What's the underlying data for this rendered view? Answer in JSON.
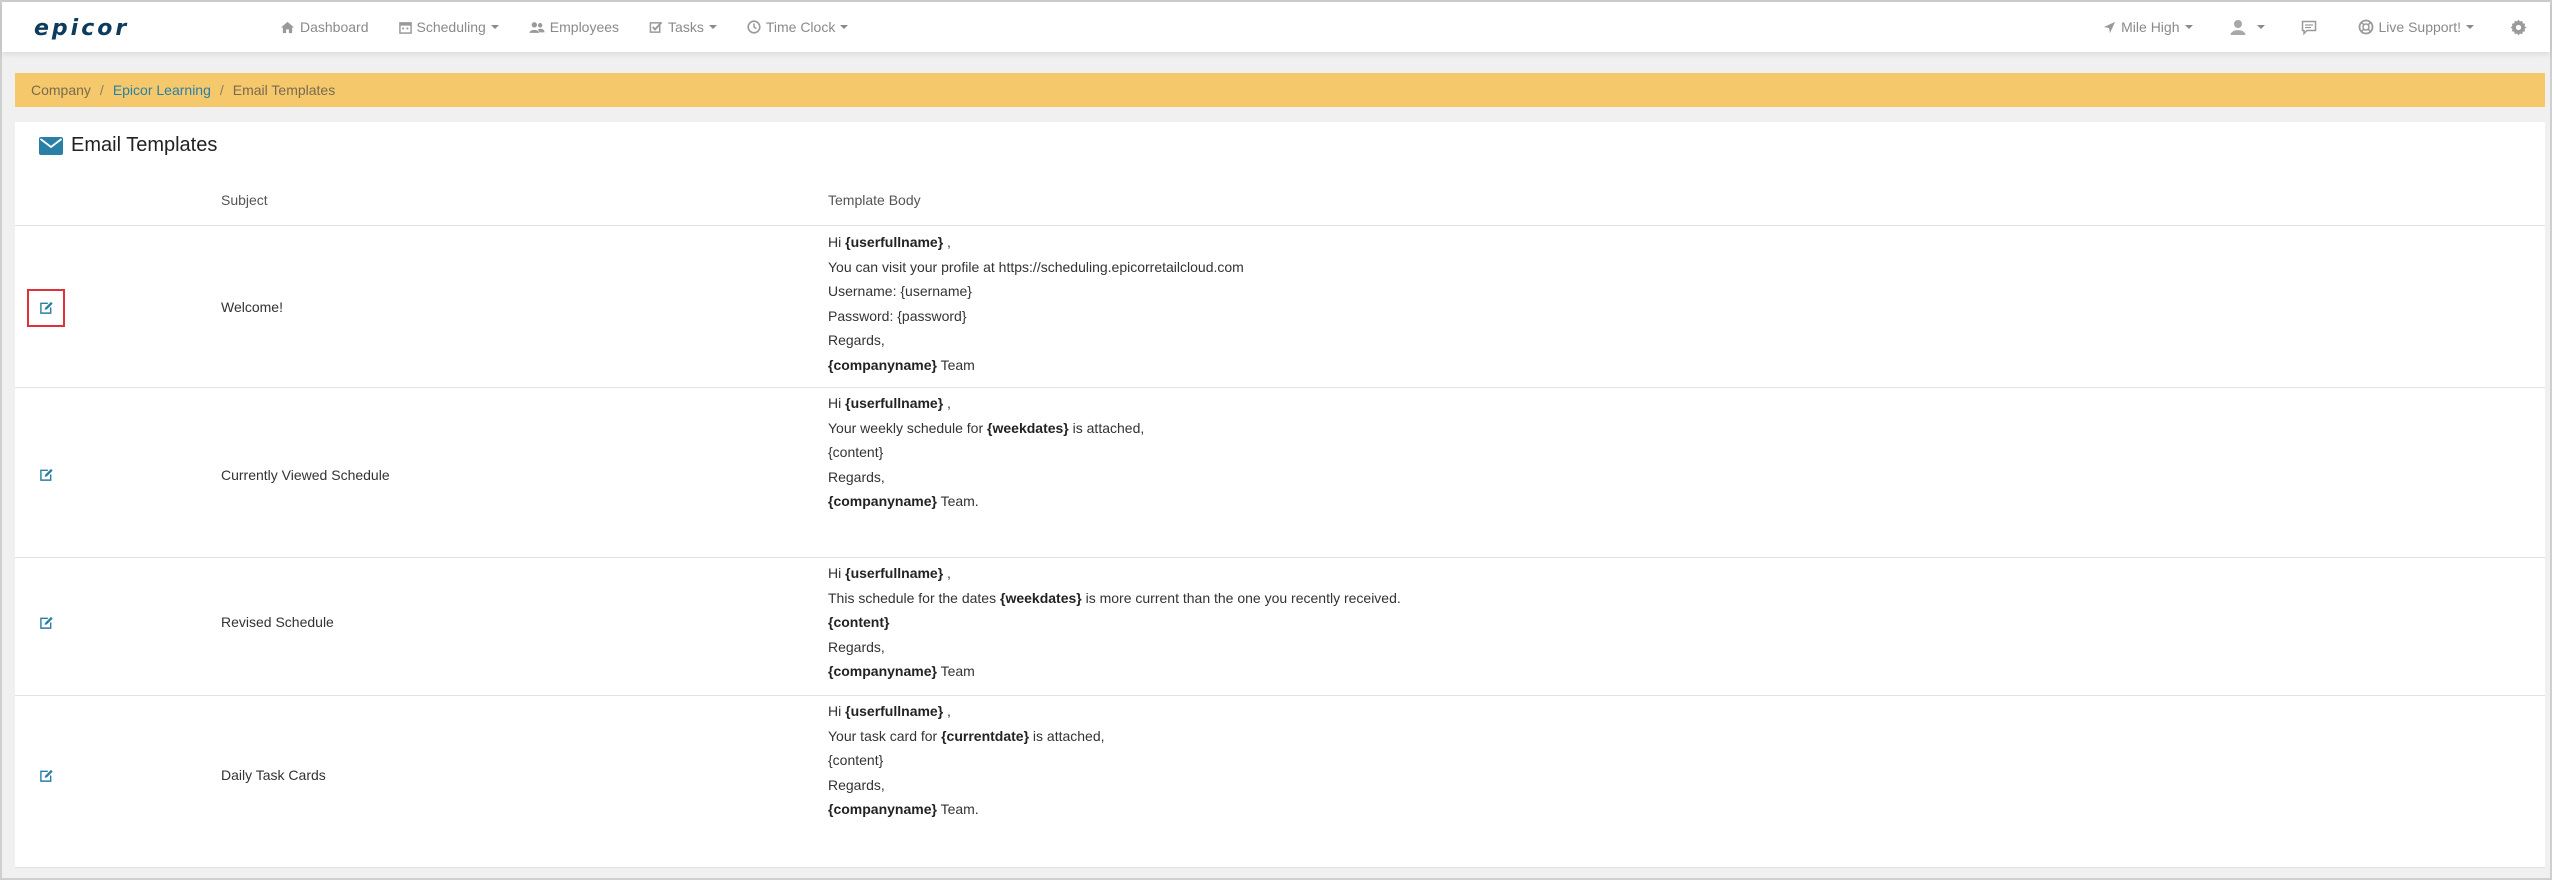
{
  "nav": {
    "logo": "epicor",
    "items": [
      {
        "label": "Dashboard",
        "icon": "home-icon",
        "dropdown": false
      },
      {
        "label": "Scheduling",
        "icon": "calendar-icon",
        "dropdown": true
      },
      {
        "label": "Employees",
        "icon": "users-icon",
        "dropdown": false
      },
      {
        "label": "Tasks",
        "icon": "check-square-icon",
        "dropdown": true
      },
      {
        "label": "Time Clock",
        "icon": "clock-icon",
        "dropdown": true
      }
    ],
    "right": {
      "location": "Mile High",
      "support": "Live Support!"
    }
  },
  "breadcrumb": {
    "items": [
      "Company",
      "Epicor Learning",
      "Email Templates"
    ],
    "separator": "/"
  },
  "panel": {
    "title": "Email Templates"
  },
  "table": {
    "headers": {
      "subject": "Subject",
      "body": "Template Body"
    },
    "rows": [
      {
        "subject": "Welcome!",
        "highlighted": true,
        "lines": [
          [
            {
              "t": "Hi "
            },
            {
              "t": "{userfullname}",
              "b": true
            },
            {
              "t": " ,"
            }
          ],
          [
            {
              "t": "You can visit your profile at https://scheduling.epicorretailcloud.com"
            }
          ],
          [
            {
              "t": "Username: {username}"
            }
          ],
          [
            {
              "t": "Password: {password}"
            }
          ],
          [
            {
              "t": "Regards,"
            }
          ],
          [
            {
              "t": "{companyname}",
              "b": true
            },
            {
              "t": " Team"
            }
          ]
        ]
      },
      {
        "subject": "Currently Viewed Schedule",
        "highlighted": false,
        "lines": [
          [
            {
              "t": "Hi "
            },
            {
              "t": "{userfullname}",
              "b": true
            },
            {
              "t": " ,"
            }
          ],
          [
            {
              "t": "Your weekly schedule for "
            },
            {
              "t": "{weekdates}",
              "b": true
            },
            {
              "t": " is attached,"
            }
          ],
          [
            {
              "t": "{content}"
            }
          ],
          [
            {
              "t": "Regards,"
            }
          ],
          [
            {
              "t": "{companyname}",
              "b": true
            },
            {
              "t": " Team."
            }
          ]
        ]
      },
      {
        "subject": "Revised Schedule",
        "highlighted": false,
        "lines": [
          [
            {
              "t": "Hi "
            },
            {
              "t": "{userfullname}",
              "b": true
            },
            {
              "t": " ,"
            }
          ],
          [
            {
              "t": "This schedule for the dates "
            },
            {
              "t": "{weekdates}",
              "b": true
            },
            {
              "t": " is more current than the one you recently received."
            }
          ],
          [
            {
              "t": "{content}",
              "b": true
            }
          ],
          [
            {
              "t": "Regards,"
            }
          ],
          [
            {
              "t": "{companyname}",
              "b": true
            },
            {
              "t": " Team"
            }
          ]
        ]
      },
      {
        "subject": "Daily Task Cards",
        "highlighted": false,
        "lines": [
          [
            {
              "t": "Hi "
            },
            {
              "t": "{userfullname}",
              "b": true
            },
            {
              "t": " ,"
            }
          ],
          [
            {
              "t": "Your task card for "
            },
            {
              "t": "{currentdate}",
              "b": true
            },
            {
              "t": " is attached,"
            }
          ],
          [
            {
              "t": "{content}"
            }
          ],
          [
            {
              "t": "Regards,"
            }
          ],
          [
            {
              "t": "{companyname}",
              "b": true
            },
            {
              "t": " Team."
            }
          ]
        ]
      }
    ]
  },
  "colors": {
    "accent": "#2a7fa7",
    "breadcrumb_bg": "#f5c96b",
    "highlight": "#e0303a",
    "logo": "#0c3b5e"
  }
}
